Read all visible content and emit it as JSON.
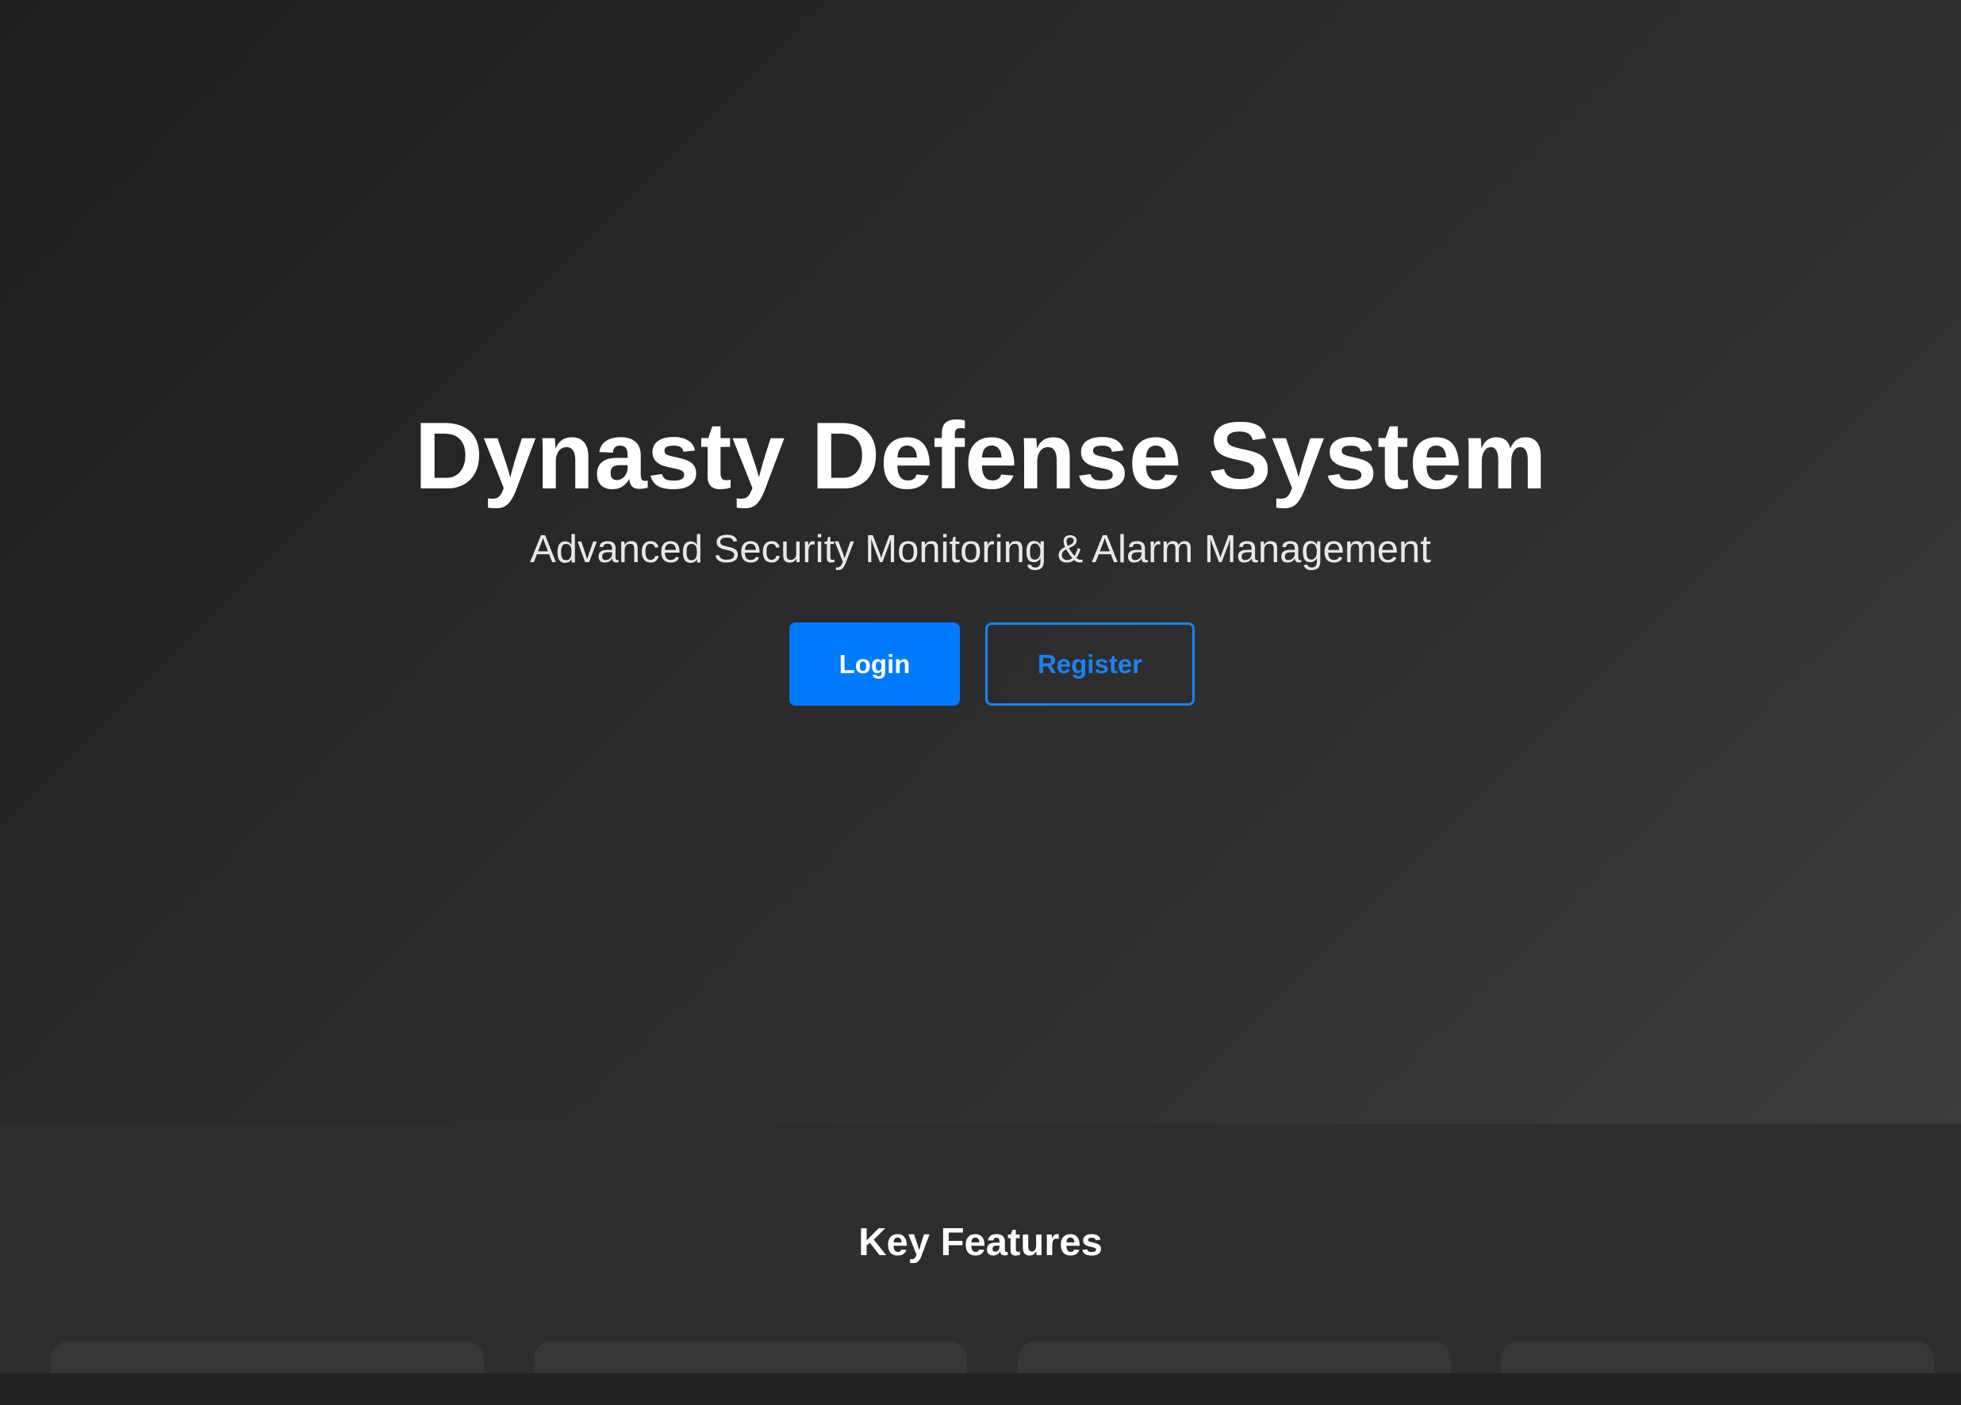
{
  "hero": {
    "title": "Dynasty Defense System",
    "subtitle": "Advanced Security Monitoring & Alarm Management",
    "login_label": "Login",
    "register_label": "Register"
  },
  "features": {
    "title": "Key Features",
    "card_count_visible": 4
  },
  "colors": {
    "primary": "#007bff",
    "outline": "#1a82f0",
    "text": "#ffffff"
  }
}
